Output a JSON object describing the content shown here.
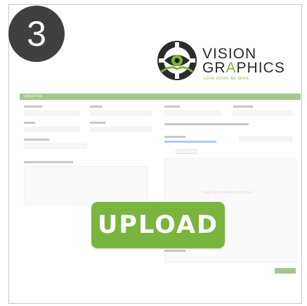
{
  "step": {
    "number": "3"
  },
  "logo": {
    "line1": "VISION",
    "line2_a": "GR",
    "line2_b": "A",
    "line2_c": "PHICS",
    "tagline": "LOOK GOOD. BE SEEN.",
    "mark_icon": "eye-gear-icon"
  },
  "form": {
    "header": "Upload File",
    "drop_hint": "Drop Files or Browse to Upload"
  },
  "cta": {
    "label": "UPLOAD"
  },
  "colors": {
    "brand_green": "#7ab53f",
    "form_bar": "#5a9a2e",
    "badge": "#3f3f3f"
  }
}
